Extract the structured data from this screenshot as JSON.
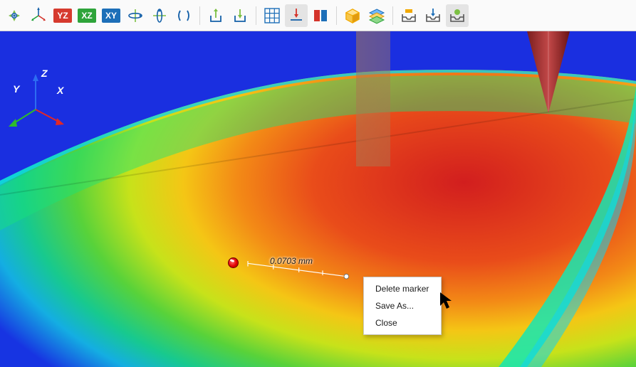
{
  "toolbar": {
    "planes": {
      "yz": "YZ",
      "xz": "XZ",
      "xy": "XY"
    }
  },
  "axes": {
    "x": "X",
    "y": "Y",
    "z": "Z"
  },
  "marker": {
    "measurement": "0.0703 mm"
  },
  "context_menu": {
    "delete": "Delete marker",
    "saveas": "Save As...",
    "close": "Close"
  }
}
